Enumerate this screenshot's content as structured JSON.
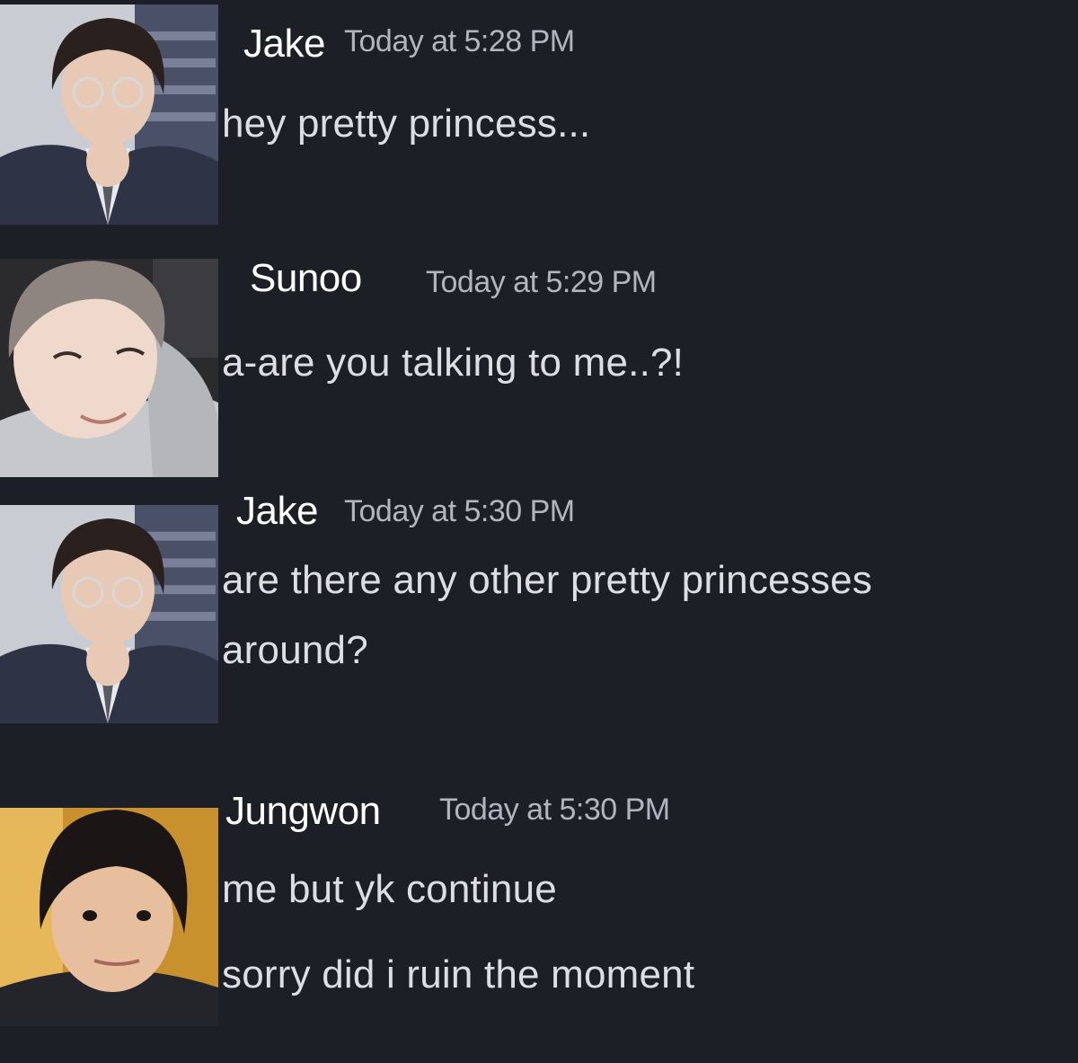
{
  "messages": [
    {
      "author": "Jake",
      "timestamp": "Today at 5:28 PM",
      "avatar": "jake-avatar",
      "lines": [
        "hey pretty princess..."
      ]
    },
    {
      "author": "Sunoo",
      "timestamp": "Today at 5:29 PM",
      "avatar": "sunoo-avatar",
      "lines": [
        "a-are you talking to me..?!"
      ]
    },
    {
      "author": "Jake",
      "timestamp": "Today at 5:30 PM",
      "avatar": "jake-avatar",
      "lines": [
        "are there any other pretty princesses",
        "around?"
      ]
    },
    {
      "author": "Jungwon",
      "timestamp": "Today at 5:30 PM",
      "avatar": "jungwon-avatar",
      "lines": [
        "me but yk continue",
        "sorry did i ruin the moment"
      ]
    }
  ],
  "colors": {
    "background": "#1c1f26",
    "author": "#ffffff",
    "timestamp": "#b1b5bd",
    "message_text": "#dcdee3"
  }
}
